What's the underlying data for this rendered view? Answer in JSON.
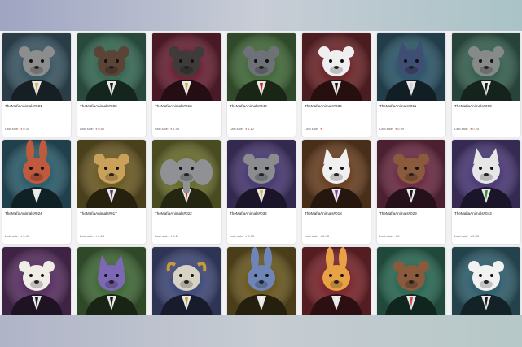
{
  "collection_prefix": "TheMafiaAnimals",
  "last_sale_label": "Last sale:",
  "eth_icon": "eth-icon",
  "cards": [
    {
      "name": "TheMafiaAnimals#001",
      "price": "0.35",
      "bg": "#3e5966",
      "fur": "#8d8d8d",
      "accent": "#d8b43a",
      "animal": "bear"
    },
    {
      "name": "TheMafiaAnimals#002",
      "price": "0.80",
      "bg": "#3a6b57",
      "fur": "#5b4436",
      "accent": "#1a1a1a",
      "animal": "bear"
    },
    {
      "name": "TheMafiaAnimals#013",
      "price": "1.95",
      "bg": "#6b2638",
      "fur": "#3f3b3a",
      "accent": "#d8b43a",
      "animal": "bear"
    },
    {
      "name": "TheMafiaAnimals#040",
      "price": "1.12",
      "bg": "#466b3d",
      "fur": "#6e7278",
      "accent": "#c22a2a",
      "animal": "ape"
    },
    {
      "name": "TheMafiaAnimals#035",
      "price": "",
      "bg": "#6e2a2e",
      "fur": "#efefef",
      "accent": "#1a1a1a",
      "animal": "panda"
    },
    {
      "name": "TheMafiaAnimals#011",
      "price": "0.99",
      "bg": "#31596b",
      "fur": "#3f4e73",
      "accent": "#d1d1d1",
      "animal": "wolf"
    },
    {
      "name": "TheMafiaAnimals#010",
      "price": "0.25",
      "bg": "#3b6354",
      "fur": "#868a88",
      "accent": "#1a1a1a",
      "animal": "raccoon"
    },
    {
      "name": "TheMafiaAnimals#024",
      "price": "0.40",
      "bg": "#2f5f6d",
      "fur": "#c05a3e",
      "accent": "#efefef",
      "animal": "rabbit"
    },
    {
      "name": "TheMafiaAnimals#017",
      "price": "0.25",
      "bg": "#6d5d29",
      "fur": "#c9a15b",
      "accent": "#5a3c6b",
      "animal": "leopard"
    },
    {
      "name": "TheMafiaAnimals#022",
      "price": "0.11",
      "bg": "#6a6d30",
      "fur": "#8f9194",
      "accent": "#c22a2a",
      "animal": "elephant"
    },
    {
      "name": "TheMafiaAnimals#032",
      "price": "0.33",
      "bg": "#4b3c72",
      "fur": "#8a8c90",
      "accent": "#d8b43a",
      "animal": "ape"
    },
    {
      "name": "TheMafiaAnimals#018",
      "price": "0.45",
      "bg": "#6b4326",
      "fur": "#f0f0f0",
      "accent": "#8d3ea3",
      "animal": "cat"
    },
    {
      "name": "TheMafiaAnimals#029",
      "price": "0",
      "bg": "#6d2f47",
      "fur": "#8a5a3d",
      "accent": "#1a1a1a",
      "animal": "bear"
    },
    {
      "name": "TheMafiaAnimals#043",
      "price": "0.30",
      "bg": "#4e3d78",
      "fur": "#e6e6e6",
      "accent": "#3d8a3d",
      "animal": "lion"
    },
    {
      "name": "",
      "price": "",
      "bg": "#5a3363",
      "fur": "#f0ece6",
      "accent": "#1a1a1a",
      "animal": "weasel"
    },
    {
      "name": "",
      "price": "",
      "bg": "#446a3b",
      "fur": "#7d68b5",
      "accent": "#1a1a1a",
      "animal": "cat"
    },
    {
      "name": "",
      "price": "",
      "bg": "#434c7a",
      "fur": "#d8d2c4",
      "accent": "#c99a3a",
      "animal": "goat"
    },
    {
      "name": "",
      "price": "",
      "bg": "#6b5a24",
      "fur": "#6f85b8",
      "accent": "#efefef",
      "animal": "rabbit"
    },
    {
      "name": "",
      "price": "",
      "bg": "#7a2a30",
      "fur": "#e8a245",
      "accent": "#efefef",
      "animal": "rabbit"
    },
    {
      "name": "",
      "price": "",
      "bg": "#2f6a56",
      "fur": "#8a5a3d",
      "accent": "#d84a4a",
      "animal": "weasel"
    },
    {
      "name": "",
      "price": "",
      "bg": "#34616e",
      "fur": "#f2f2f2",
      "accent": "#1a1a1a",
      "animal": "bear"
    }
  ]
}
